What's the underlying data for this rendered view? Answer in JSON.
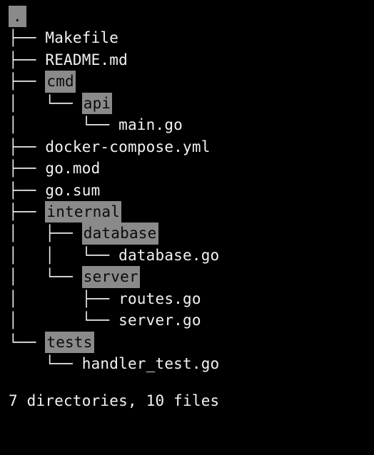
{
  "root": ".",
  "lines": [
    {
      "prefix": "├── ",
      "name": "Makefile",
      "dir": false
    },
    {
      "prefix": "├── ",
      "name": "README.md",
      "dir": false
    },
    {
      "prefix": "├── ",
      "name": "cmd",
      "dir": true
    },
    {
      "prefix": "│   └── ",
      "name": "api",
      "dir": true
    },
    {
      "prefix": "│       └── ",
      "name": "main.go",
      "dir": false
    },
    {
      "prefix": "├── ",
      "name": "docker-compose.yml",
      "dir": false
    },
    {
      "prefix": "├── ",
      "name": "go.mod",
      "dir": false
    },
    {
      "prefix": "├── ",
      "name": "go.sum",
      "dir": false
    },
    {
      "prefix": "├── ",
      "name": "internal",
      "dir": true
    },
    {
      "prefix": "│   ├── ",
      "name": "database",
      "dir": true
    },
    {
      "prefix": "│   │   └── ",
      "name": "database.go",
      "dir": false
    },
    {
      "prefix": "│   └── ",
      "name": "server",
      "dir": true
    },
    {
      "prefix": "│       ├── ",
      "name": "routes.go",
      "dir": false
    },
    {
      "prefix": "│       └── ",
      "name": "server.go",
      "dir": false
    },
    {
      "prefix": "└── ",
      "name": "tests",
      "dir": true
    },
    {
      "prefix": "    └── ",
      "name": "handler_test.go",
      "dir": false
    }
  ],
  "summary": "7 directories, 10 files"
}
